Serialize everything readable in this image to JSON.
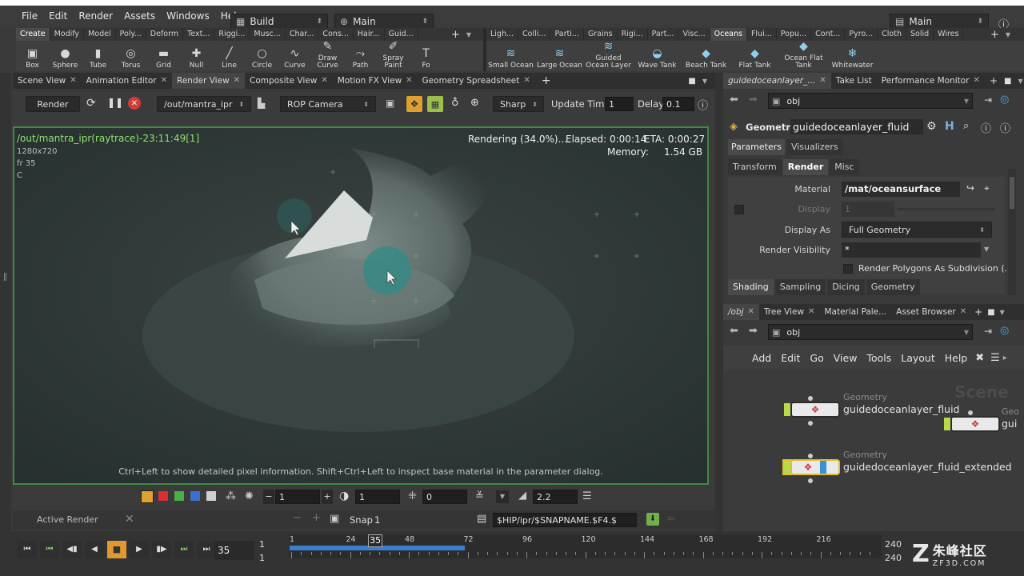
{
  "menu": [
    "File",
    "Edit",
    "Render",
    "Assets",
    "Windows",
    "Help"
  ],
  "desktop": {
    "build": "Build",
    "main": "Main",
    "right_main": "Main"
  },
  "shelf_tabs_left": [
    "Create",
    "Modify",
    "Model",
    "Poly...",
    "Deform",
    "Text...",
    "Riggi...",
    "Musc...",
    "Char...",
    "Cons...",
    "Hair...",
    "Guid..."
  ],
  "shelf_tabs_right": [
    "Ligh...",
    "Colli...",
    "Parti...",
    "Grains",
    "Rigi...",
    "Part...",
    "Visc...",
    "Oceans",
    "Flui...",
    "Popu...",
    "Cont...",
    "Pyro...",
    "Cloth",
    "Solid",
    "Wires"
  ],
  "shelf_tools_left": [
    {
      "label": "Box",
      "icon": "box-icon",
      "glyph": "▣"
    },
    {
      "label": "Sphere",
      "icon": "sphere-icon",
      "glyph": "●"
    },
    {
      "label": "Tube",
      "icon": "tube-icon",
      "glyph": "▮"
    },
    {
      "label": "Torus",
      "icon": "torus-icon",
      "glyph": "◎"
    },
    {
      "label": "Grid",
      "icon": "grid-icon",
      "glyph": "▬"
    },
    {
      "label": "Null",
      "icon": "null-icon",
      "glyph": "✚"
    },
    {
      "label": "Line",
      "icon": "line-icon",
      "glyph": "╱"
    },
    {
      "label": "Circle",
      "icon": "circle-icon",
      "glyph": "○"
    },
    {
      "label": "Curve",
      "icon": "curve-icon",
      "glyph": "∿"
    },
    {
      "label": "Draw Curve",
      "icon": "draw-curve-icon",
      "glyph": "✎"
    },
    {
      "label": "Path",
      "icon": "path-icon",
      "glyph": "⤳"
    },
    {
      "label": "Spray Paint",
      "icon": "spray-paint-icon",
      "glyph": "✐"
    },
    {
      "label": "Fo",
      "icon": "font-icon",
      "glyph": "T"
    }
  ],
  "shelf_tools_right": [
    {
      "label": "Small Ocean",
      "icon": "small-ocean-icon",
      "glyph": "≋"
    },
    {
      "label": "Large Ocean",
      "icon": "large-ocean-icon",
      "glyph": "≋"
    },
    {
      "label": "Guided Ocean Layer",
      "icon": "guided-ocean-layer-icon",
      "glyph": "≋"
    },
    {
      "label": "Wave Tank",
      "icon": "wave-tank-icon",
      "glyph": "◒"
    },
    {
      "label": "Beach Tank",
      "icon": "beach-tank-icon",
      "glyph": "◆"
    },
    {
      "label": "Flat Tank",
      "icon": "flat-tank-icon",
      "glyph": "◆"
    },
    {
      "label": "Ocean Flat Tank",
      "icon": "ocean-flat-tank-icon",
      "glyph": "◆"
    },
    {
      "label": "Whitewater",
      "icon": "whitewater-icon",
      "glyph": "❄"
    }
  ],
  "pane_tabs": [
    "Scene View",
    "Animation Editor",
    "Render View",
    "Composite View",
    "Motion FX View",
    "Geometry Spreadsheet"
  ],
  "render_toolbar": {
    "render": "Render",
    "driver": "/out/mantra_ipr",
    "camera": "ROP Camera",
    "sharp": "Sharp",
    "update_label": "Update Time",
    "update_value": "1",
    "delay_label": "Delay",
    "delay_value": "0.1"
  },
  "render_overlay": {
    "title": "/out/mantra_ipr(raytrace)-23:11:49[1]",
    "res": "1280x720",
    "frame": "fr 35",
    "channel": "C",
    "status": "Rendering (34.0%)....",
    "elapsed": "Elapsed: 0:00:14",
    "eta": "ETA: 0:00:27",
    "memory_label": "Memory:",
    "memory_value": "1.54 GB",
    "hint": "Ctrl+Left to show detailed pixel information. Shift+Ctrl+Left to inspect base material in the parameter dialog.",
    "progress": 0.34
  },
  "view_bar": {
    "v1": "1",
    "v2": "1",
    "v3": "0",
    "v4": "2.2"
  },
  "snap_bar": {
    "active": "Active Render",
    "snap": "Snap",
    "snap_value": "1",
    "path": "$HIP/ipr/$SNAPNAME.$F4.$"
  },
  "timeline": {
    "frame": "35",
    "start": "1",
    "start2": "1",
    "end": "240",
    "end2": "240",
    "cursor": "35",
    "ticks": [
      "1",
      "24",
      "48",
      "72",
      "96",
      "120",
      "144",
      "168",
      "192",
      "216"
    ]
  },
  "param_pane": {
    "tabs": [
      "guidedoceanlayer_...",
      "Take List",
      "Performance Monitor"
    ],
    "path": "obj",
    "node_type": "Geometry",
    "node_name": "guidedoceanlayer_fluid",
    "subtabs": [
      "Parameters",
      "Visualizers"
    ],
    "sections": [
      "Transform",
      "Render",
      "Misc"
    ],
    "material_label": "Material",
    "material_value": "/mat/oceansurface",
    "display_label": "Display",
    "display_value": "1",
    "display_as_label": "Display As",
    "display_as_value": "Full Geometry",
    "render_vis_label": "Render Visibility",
    "render_vis_value": "*",
    "subdiv_label": "Render Polygons As Subdivision (...",
    "bottom_tabs": [
      "Shading",
      "Sampling",
      "Dicing",
      "Geometry"
    ]
  },
  "network_pane": {
    "tabs": [
      "/obj",
      "Tree View",
      "Material Pale...",
      "Asset Browser"
    ],
    "path": "obj",
    "menu": [
      "Add",
      "Edit",
      "Go",
      "View",
      "Tools",
      "Layout",
      "Help"
    ],
    "watermark": "Scene",
    "nodes": [
      {
        "type": "Geometry",
        "name": "guidedoceanlayer_fluid"
      },
      {
        "type": "Geo",
        "name": "gui"
      },
      {
        "type": "Geometry",
        "name": "guidedoceanlayer_fluid_extended"
      }
    ]
  },
  "watermark": {
    "brand": "朱峰社区",
    "url": "ZF3D.COM"
  }
}
